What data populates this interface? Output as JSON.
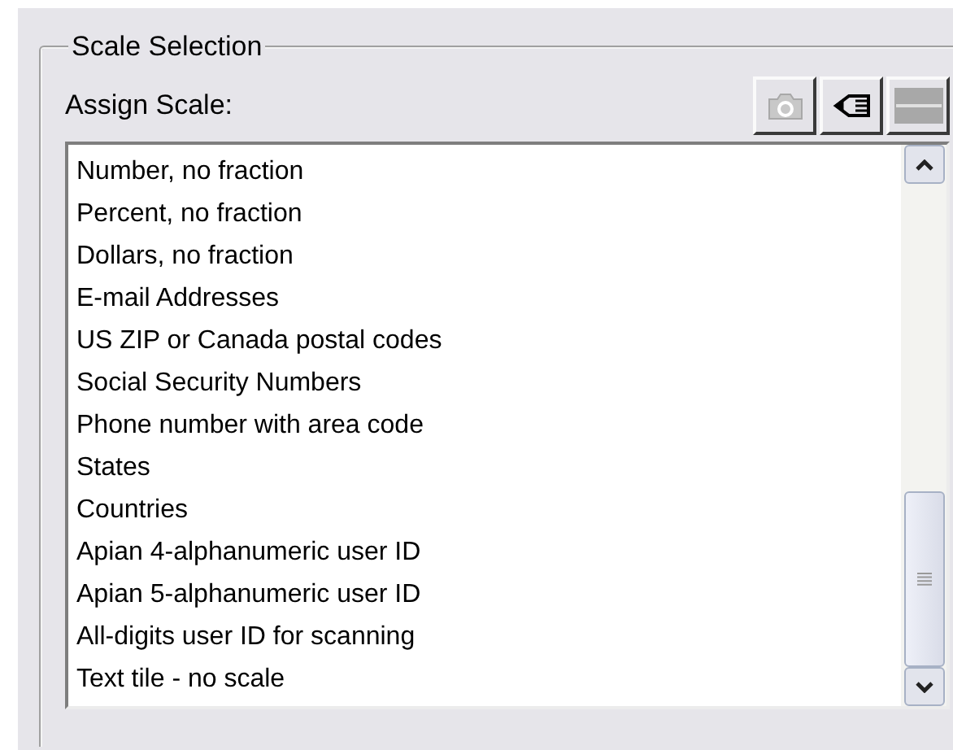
{
  "group": {
    "title": "Scale Selection"
  },
  "label": "Assign Scale:",
  "tools": [
    {
      "kind": "camera",
      "disabled": true
    },
    {
      "kind": "pencil",
      "disabled": false
    },
    {
      "kind": "dash",
      "disabled": true
    }
  ],
  "list": {
    "items": [
      "Number, no fraction",
      "Percent, no fraction",
      "Dollars, no fraction",
      "E-mail Addresses",
      "US ZIP or Canada postal codes",
      "Social Security Numbers",
      "Phone number with area code",
      "States",
      "Countries",
      "Apian 4-alphanumeric user ID",
      "Apian 5-alphanumeric user ID",
      "All-digits user ID for scanning",
      "Text tile - no scale"
    ]
  }
}
